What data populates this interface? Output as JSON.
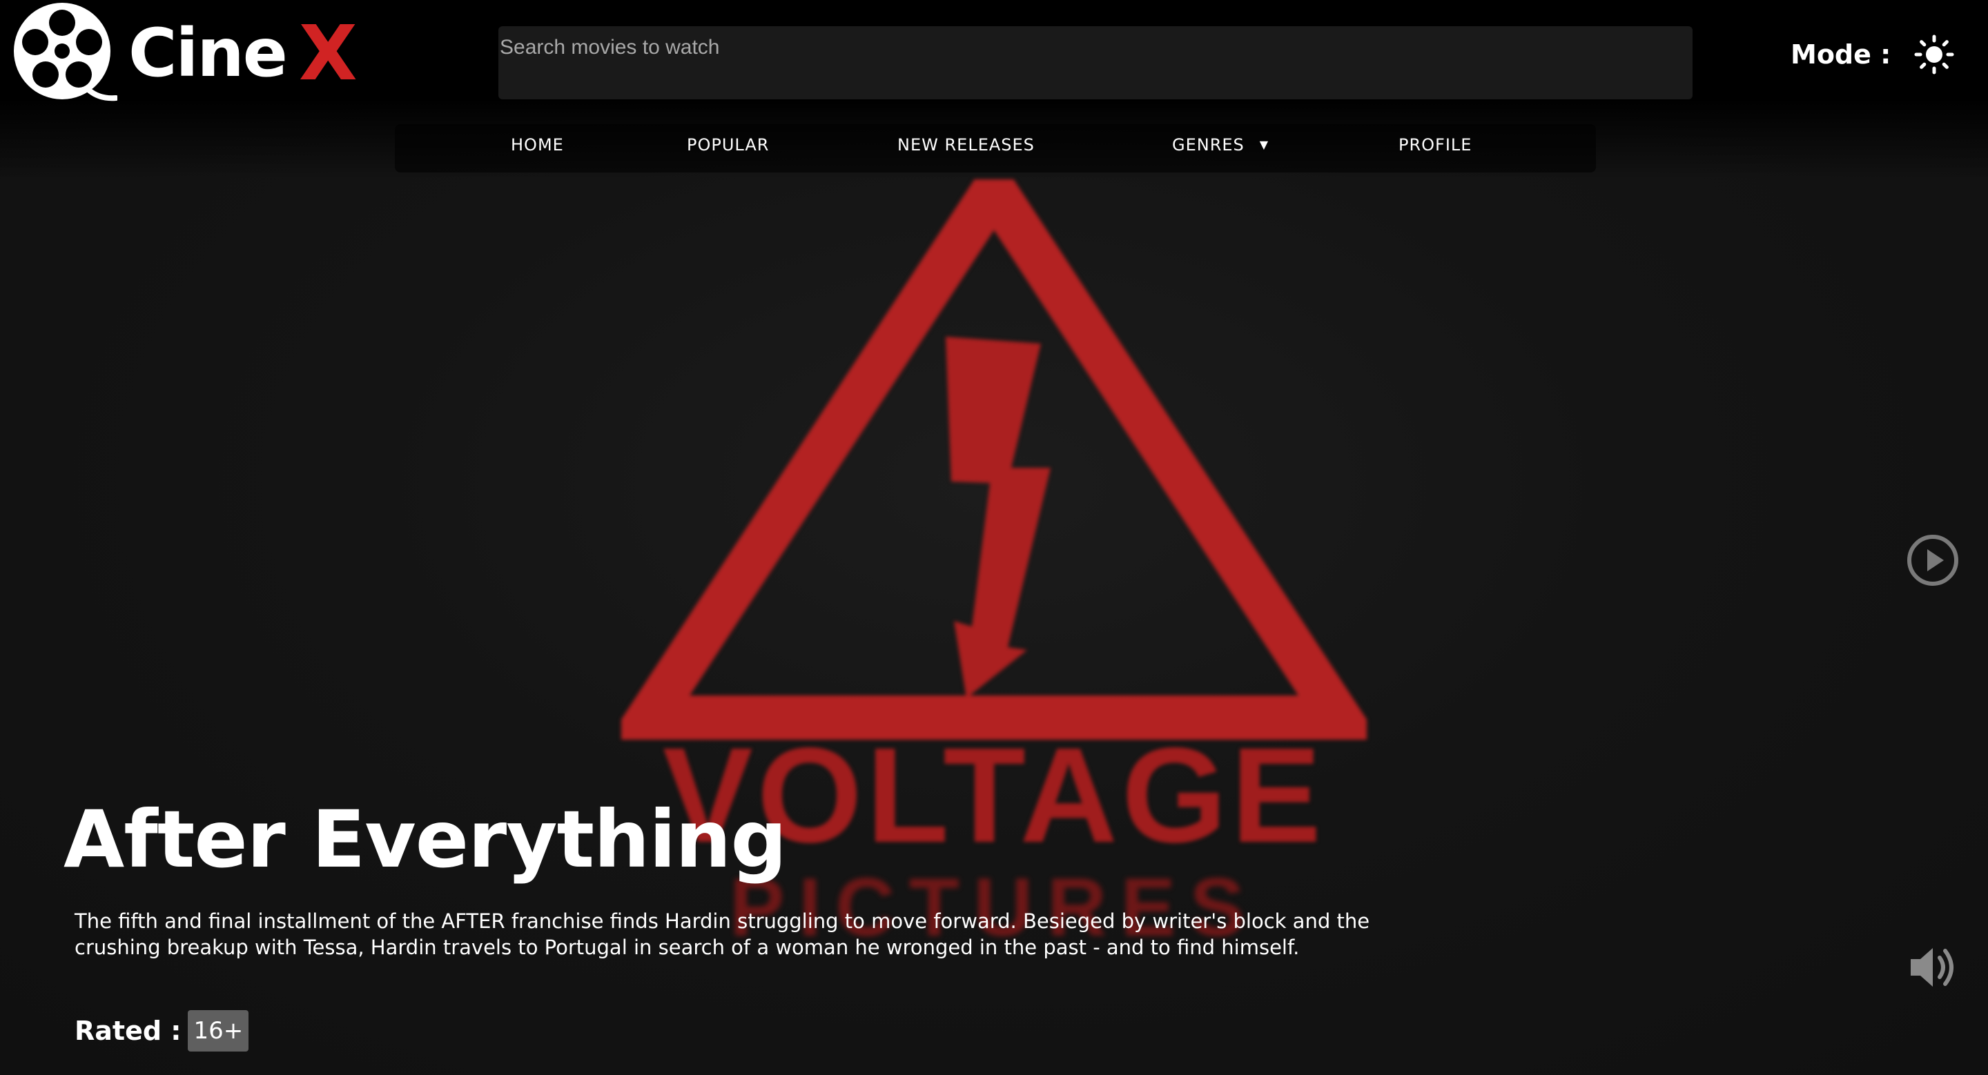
{
  "app": {
    "brand_name": "Cine",
    "brand_x": "X",
    "brand_accent_color": "#d12323"
  },
  "search": {
    "placeholder": "Search movies to watch",
    "value": ""
  },
  "mode": {
    "label": "Mode :",
    "icon": "sun-icon",
    "theme": "dark"
  },
  "nav": {
    "items": [
      {
        "label": "HOME"
      },
      {
        "label": "POPULAR"
      },
      {
        "label": "NEW RELEASES"
      },
      {
        "label": "GENRES",
        "has_dropdown": true
      },
      {
        "label": "PROFILE"
      }
    ]
  },
  "hero": {
    "background_art": {
      "icon": "high-voltage-warning-icon",
      "text": "VOLTAGE",
      "subtext": "PICTURES",
      "color": "#a01d1d"
    },
    "controls": {
      "play_icon": "play-circle-icon",
      "volume_icon": "volume-icon"
    }
  },
  "movie": {
    "title": "After Everything",
    "description": "The fifth and final installment of the AFTER franchise finds Hardin struggling to move forward. Besieged by writer's block and the crushing breakup with Tessa, Hardin travels to Portugal in search of a woman he wronged in the past - and to find himself.",
    "rating_label": "Rated :",
    "rating": "16+"
  }
}
